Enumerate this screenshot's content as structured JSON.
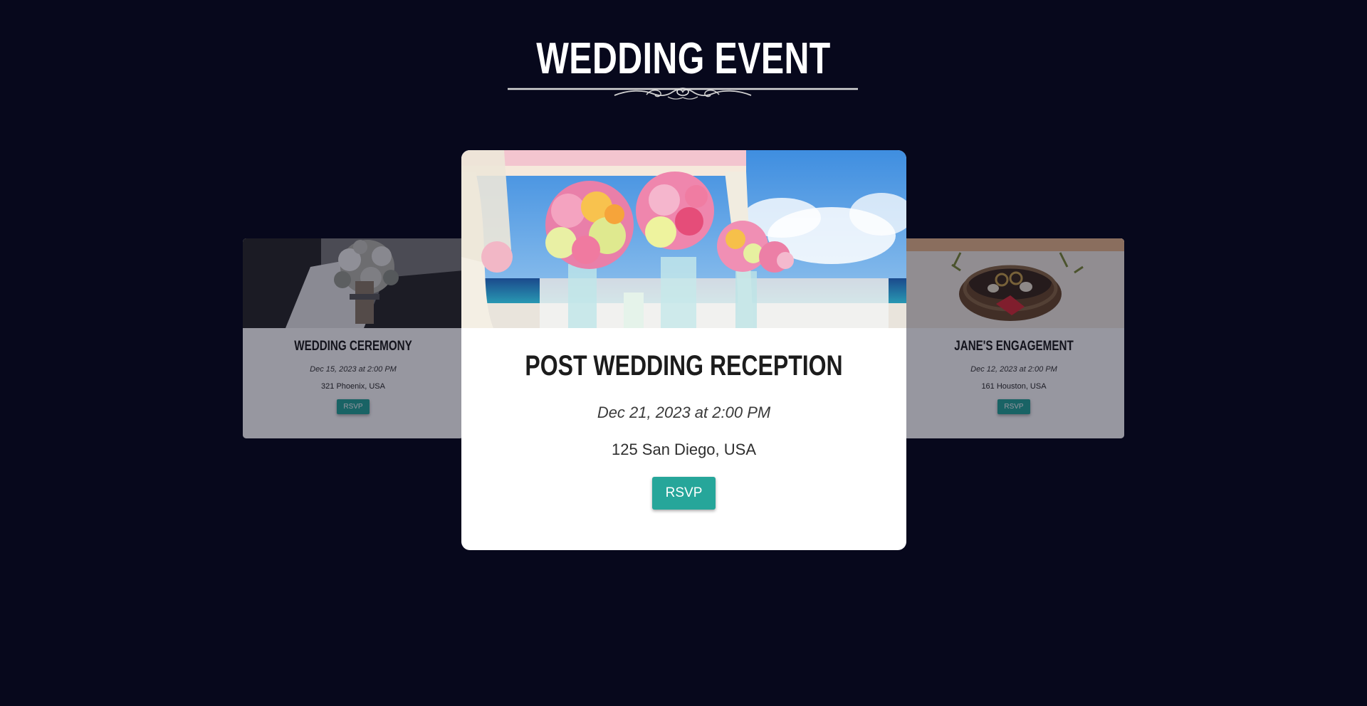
{
  "page": {
    "title": "WEDDING EVENT",
    "background_color": "#07081c",
    "accent_color": "#26a69a"
  },
  "events": {
    "left": {
      "title": "WEDDING CEREMONY",
      "date": "Dec 15, 2023 at 2:00 PM",
      "address": "321 Phoenix, USA",
      "rsvp_label": "RSVP",
      "image": "bouquet-photo"
    },
    "center": {
      "title": "POST WEDDING RECEPTION",
      "date": "Dec 21, 2023 at 2:00 PM",
      "address": "125 San Diego, USA",
      "rsvp_label": "RSVP",
      "image": "beach-flowers-photo"
    },
    "right": {
      "title": "JANE'S ENGAGEMENT",
      "date": "Dec 12, 2023 at 2:00 PM",
      "address": "161 Houston, USA",
      "rsvp_label": "RSVP",
      "image": "rings-nest-photo"
    }
  }
}
